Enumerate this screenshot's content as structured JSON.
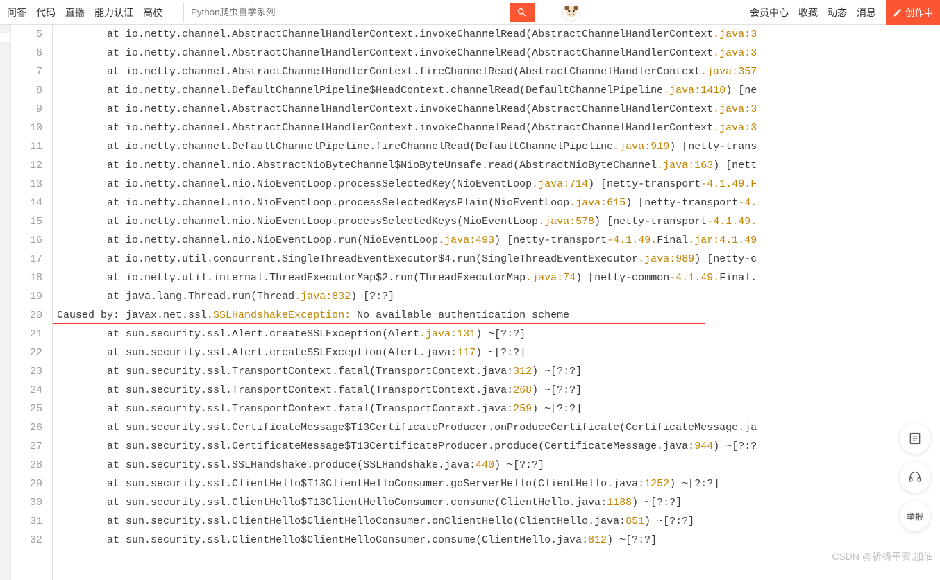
{
  "nav": {
    "items": [
      "问答",
      "代码",
      "直播",
      "能力认证",
      "高校"
    ],
    "right": {
      "vip": "会员中心",
      "fav": "收藏",
      "trend": "动态",
      "msg": "消息",
      "compose": "创作中"
    }
  },
  "search": {
    "placeholder": "Python爬虫自学系列"
  },
  "gutter_start": 5,
  "highlight_line": 20,
  "lines": [
    {
      "indent": "        at ",
      "cls": "io.netty.channel.AbstractChannelHandlerContext.invokeChannelRead",
      "paren": "(AbstractChannelHandlerContext",
      "file": ".java:",
      "ln": "3"
    },
    {
      "indent": "        at ",
      "cls": "io.netty.channel.AbstractChannelHandlerContext.invokeChannelRead",
      "paren": "(AbstractChannelHandlerContext",
      "file": ".java:",
      "ln": "3"
    },
    {
      "indent": "        at ",
      "cls": "io.netty.channel.AbstractChannelHandlerContext.fireChannelRead",
      "paren": "(AbstractChannelHandlerContext",
      "file": ".java:",
      "ln": "357"
    },
    {
      "indent": "        at ",
      "cls": "io.netty.channel.DefaultChannelPipeline$HeadContext.channelRead",
      "paren": "(DefaultChannelPipeline",
      "file": ".java:",
      "ln": "1410",
      "tail": ") [ne"
    },
    {
      "indent": "        at ",
      "cls": "io.netty.channel.AbstractChannelHandlerContext.invokeChannelRead",
      "paren": "(AbstractChannelHandlerContext",
      "file": ".java:",
      "ln": "3"
    },
    {
      "indent": "        at ",
      "cls": "io.netty.channel.AbstractChannelHandlerContext.invokeChannelRead",
      "paren": "(AbstractChannelHandlerContext",
      "file": ".java:",
      "ln": "3"
    },
    {
      "indent": "        at ",
      "cls": "io.netty.channel.DefaultChannelPipeline.fireChannelRead",
      "paren": "(DefaultChannelPipeline",
      "file": ".java:",
      "ln": "919",
      "tail": ") [netty-trans"
    },
    {
      "indent": "        at ",
      "cls": "io.netty.channel.nio.AbstractNioByteChannel$NioByteUnsafe.read",
      "paren": "(AbstractNioByteChannel",
      "file": ".java:",
      "ln": "163",
      "tail": ") [nett"
    },
    {
      "indent": "        at ",
      "cls": "io.netty.channel.nio.NioEventLoop.processSelectedKey",
      "paren": "(NioEventLoop",
      "file": ".java:",
      "ln": "714",
      "tail": ") [netty-transport",
      "ver": "-4.1.49.F"
    },
    {
      "indent": "        at ",
      "cls": "io.netty.channel.nio.NioEventLoop.processSelectedKeysPlain",
      "paren": "(NioEventLoop",
      "file": ".java:",
      "ln": "615",
      "tail": ") [netty-transport",
      "ver": "-4."
    },
    {
      "indent": "        at ",
      "cls": "io.netty.channel.nio.NioEventLoop.processSelectedKeys",
      "paren": "(NioEventLoop",
      "file": ".java:",
      "ln": "578",
      "tail": ") [netty-transport",
      "ver": "-4.1.49."
    },
    {
      "indent": "        at ",
      "cls": "io.netty.channel.nio.NioEventLoop.run",
      "paren": "(NioEventLoop",
      "file": ".java:",
      "ln": "493",
      "tail": ") [netty-transport",
      "ver": "-4.1.49.",
      "suffix": "Final",
      "jar": ".jar:",
      "jv": "4.1.49"
    },
    {
      "indent": "        at ",
      "cls": "io.netty.util.concurrent.SingleThreadEventExecutor$4.run",
      "paren": "(SingleThreadEventExecutor",
      "file": ".java:",
      "ln": "989",
      "tail": ") [netty-c"
    },
    {
      "indent": "        at ",
      "cls": "io.netty.util.internal.ThreadExecutorMap$2.run",
      "paren": "(ThreadExecutorMap",
      "file": ".java:",
      "ln": "74",
      "tail": ") [netty-common",
      "ver": "-4.1.49.",
      "suffix": "Final."
    },
    {
      "indent": "        at ",
      "cls": "java.lang.Thread.run",
      "paren": "(Thread",
      "file": ".java:",
      "ln": "832",
      "tail": ") [?:?]"
    },
    {
      "caused": true,
      "pre": "Caused by: javax.net.ssl.",
      "exc": "SSLHandshakeException:",
      "msg": " No available authentication scheme"
    },
    {
      "indent": "        at ",
      "cls": "sun.security.ssl.Alert.createSSLException",
      "paren": "(Alert",
      "file": ".java:",
      "ln": "131",
      "tail": ") ~[?:?]"
    },
    {
      "indent": "        at ",
      "cls": "sun.security.ssl.Alert.createSSLException",
      "paren": "(Alert.java:",
      "ln2": "117",
      "tail": ") ~[?:?]"
    },
    {
      "indent": "        at ",
      "cls": "sun.security.ssl.TransportContext.fatal",
      "paren": "(TransportContext.java:",
      "ln2": "312",
      "tail": ") ~[?:?]"
    },
    {
      "indent": "        at ",
      "cls": "sun.security.ssl.TransportContext.fatal",
      "paren": "(TransportContext.java:",
      "ln2": "268",
      "tail": ") ~[?:?]"
    },
    {
      "indent": "        at ",
      "cls": "sun.security.ssl.TransportContext.fatal",
      "paren": "(TransportContext.java:",
      "ln2": "259",
      "tail": ") ~[?:?]"
    },
    {
      "indent": "        at ",
      "cls": "sun.security.ssl.CertificateMessage$T13CertificateProducer.onProduceCertificate",
      "paren": "(CertificateMessage.ja"
    },
    {
      "indent": "        at ",
      "cls": "sun.security.ssl.CertificateMessage$T13CertificateProducer.produce",
      "paren": "(CertificateMessage.java:",
      "ln2": "944",
      "tail": ") ~[?:?"
    },
    {
      "indent": "        at ",
      "cls": "sun.security.ssl.SSLHandshake.produce",
      "paren": "(SSLHandshake.java:",
      "ln2": "440",
      "tail": ") ~[?:?]"
    },
    {
      "indent": "        at ",
      "cls": "sun.security.ssl.ClientHello$T13ClientHelloConsumer.goServerHello",
      "paren": "(ClientHello.java:",
      "ln2": "1252",
      "tail": ") ~[?:?]"
    },
    {
      "indent": "        at ",
      "cls": "sun.security.ssl.ClientHello$T13ClientHelloConsumer.consume",
      "paren": "(ClientHello.java:",
      "ln2": "1188",
      "tail": ") ~[?:?]"
    },
    {
      "indent": "        at ",
      "cls": "sun.security.ssl.ClientHello$ClientHelloConsumer.onClientHello",
      "paren": "(ClientHello.java:",
      "ln2": "851",
      "tail": ") ~[?:?]"
    },
    {
      "indent": "        at ",
      "cls": "sun.security.ssl.ClientHello$ClientHelloConsumer.consume",
      "paren": "(ClientHello.java:",
      "ln2": "812",
      "tail": ") ~[?:?]"
    }
  ],
  "float": {
    "report": "举报"
  },
  "watermark": "CSDN @祈祷平安,加油"
}
